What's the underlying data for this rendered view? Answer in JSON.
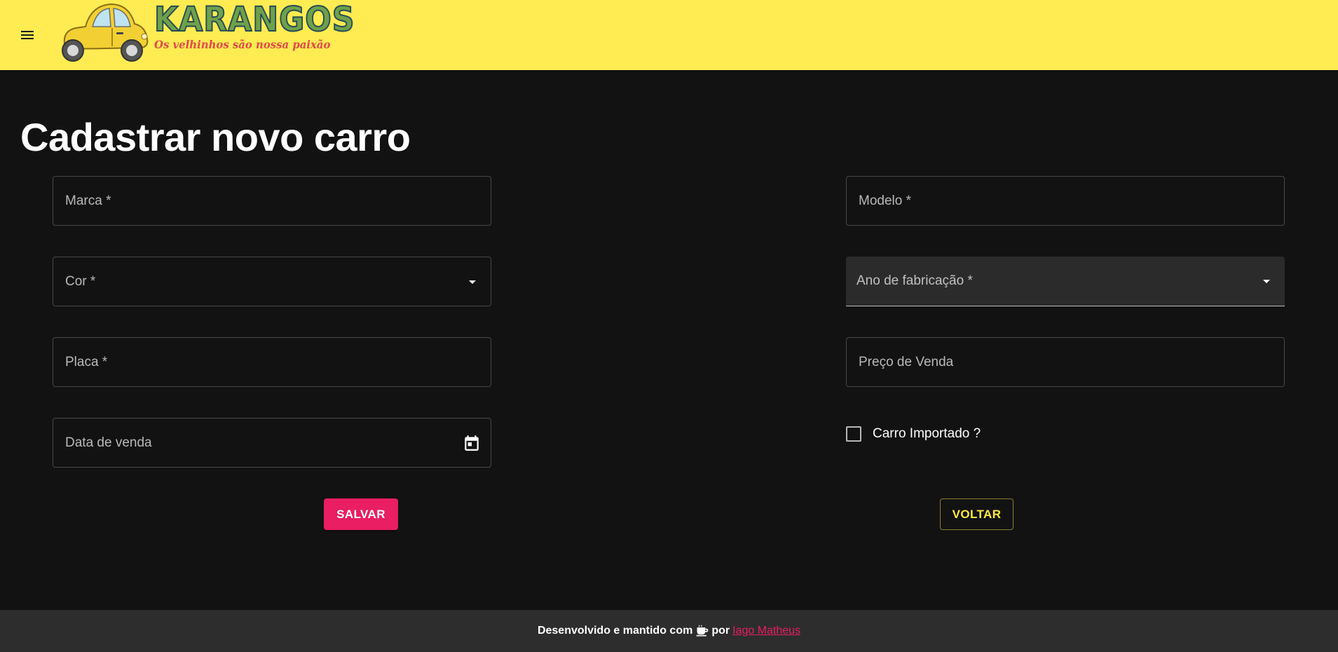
{
  "header": {
    "brand_name": "KARANGOS",
    "brand_tagline": "Os velhinhos são nossa paixão",
    "menu_icon": "menu-icon",
    "background_color": "#ffeb52"
  },
  "page": {
    "title": "Cadastrar novo carro"
  },
  "form": {
    "marca_label": "Marca *",
    "modelo_label": "Modelo *",
    "cor_label": "Cor *",
    "ano_label": "Ano de fabricação *",
    "placa_label": "Placa *",
    "preco_label": "Preço de Venda",
    "data_venda_label": "Data de venda",
    "importado_label": "Carro Importado ?",
    "importado_checked": false,
    "save_label": "SALVAR",
    "back_label": "VOLTAR",
    "save_color": "#e91e63",
    "back_color": "#ffeb3b"
  },
  "footer": {
    "text_before": "Desenvolvido e mantido com",
    "text_por": "por",
    "author_link": "Iago Matheus",
    "coffee_icon": "coffee-icon",
    "background_color": "#2d2d2d"
  }
}
